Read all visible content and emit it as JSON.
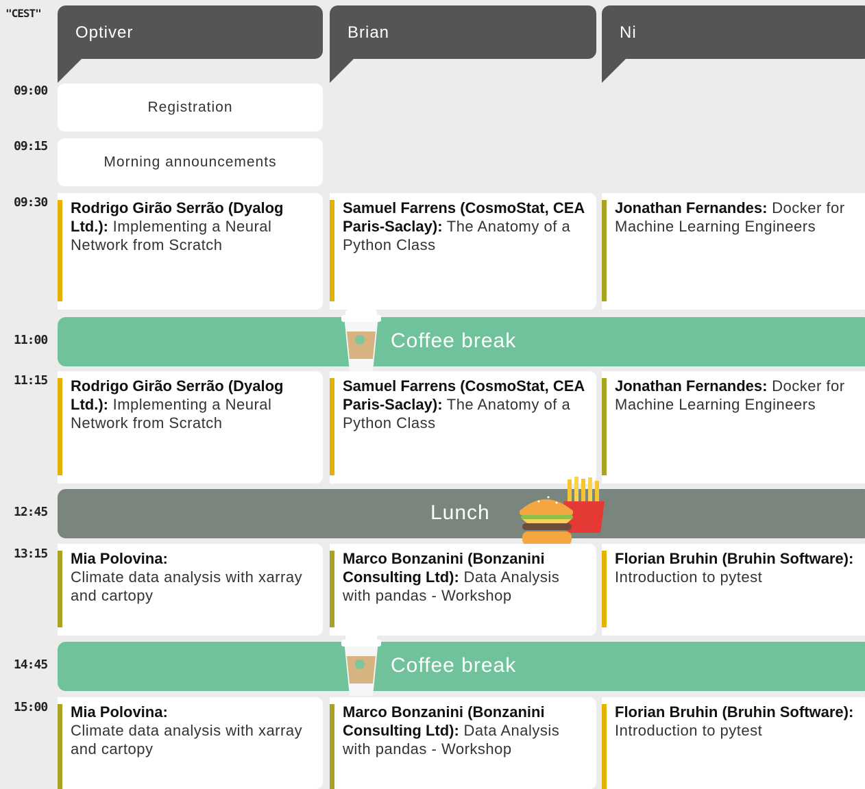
{
  "timezone": "\"CEST\"",
  "colors": {
    "header": "#555555",
    "coffee": "#70c29b",
    "lunch": "#7a867d",
    "bar_yellow": "#e3b205",
    "bar_olive": "#a8a323"
  },
  "rooms": [
    "Optiver",
    "Brian",
    "Ni"
  ],
  "times": [
    "09:00",
    "09:15",
    "09:30",
    "11:00",
    "11:15",
    "12:45",
    "13:15",
    "14:45",
    "15:00"
  ],
  "plenary": {
    "registration": "Registration",
    "announcements": "Morning announcements"
  },
  "breaks": {
    "coffee1": "Coffee break",
    "lunch": "Lunch",
    "coffee2": "Coffee break"
  },
  "icons": {
    "coffee": "coffee-cup-icon",
    "lunch": "burger-fries-icon"
  },
  "sessions": {
    "s0930": [
      {
        "speaker": "Rodrigo Girão Serrão (Dyalog Ltd.):",
        "title": "Implementing a Neural Network from Scratch"
      },
      {
        "speaker": "Samuel Farrens (CosmoStat, CEA Paris-Saclay):",
        "title": "The Anatomy of a Python Class"
      },
      {
        "speaker": "Jonathan Fernandes:",
        "title": "Docker for Machine Learning Engineers"
      }
    ],
    "s1115": [
      {
        "speaker": "Rodrigo Girão Serrão (Dyalog Ltd.):",
        "title": "Implementing a Neural Network from Scratch"
      },
      {
        "speaker": "Samuel Farrens (CosmoStat, CEA Paris-Saclay):",
        "title": "The Anatomy of a Python Class"
      },
      {
        "speaker": "Jonathan Fernandes:",
        "title": "Docker for Machine Learning Engineers"
      }
    ],
    "s1315": [
      {
        "speaker": "Mia Polovina:",
        "title": "Climate data analysis with xarray and cartopy"
      },
      {
        "speaker": "Marco Bonzanini (Bonzanini Consulting Ltd):",
        "title": "Data Analysis with pandas - Workshop"
      },
      {
        "speaker": "Florian Bruhin (Bruhin Software):",
        "title": "Introduction to pytest"
      }
    ],
    "s1500": [
      {
        "speaker": "Mia Polovina:",
        "title": "Climate data analysis with xarray and cartopy"
      },
      {
        "speaker": "Marco Bonzanini (Bonzanini Consulting Ltd):",
        "title": "Data Analysis with pandas - Workshop"
      },
      {
        "speaker": "Florian Bruhin (Bruhin Software):",
        "title": "Introduction to pytest"
      }
    ]
  }
}
